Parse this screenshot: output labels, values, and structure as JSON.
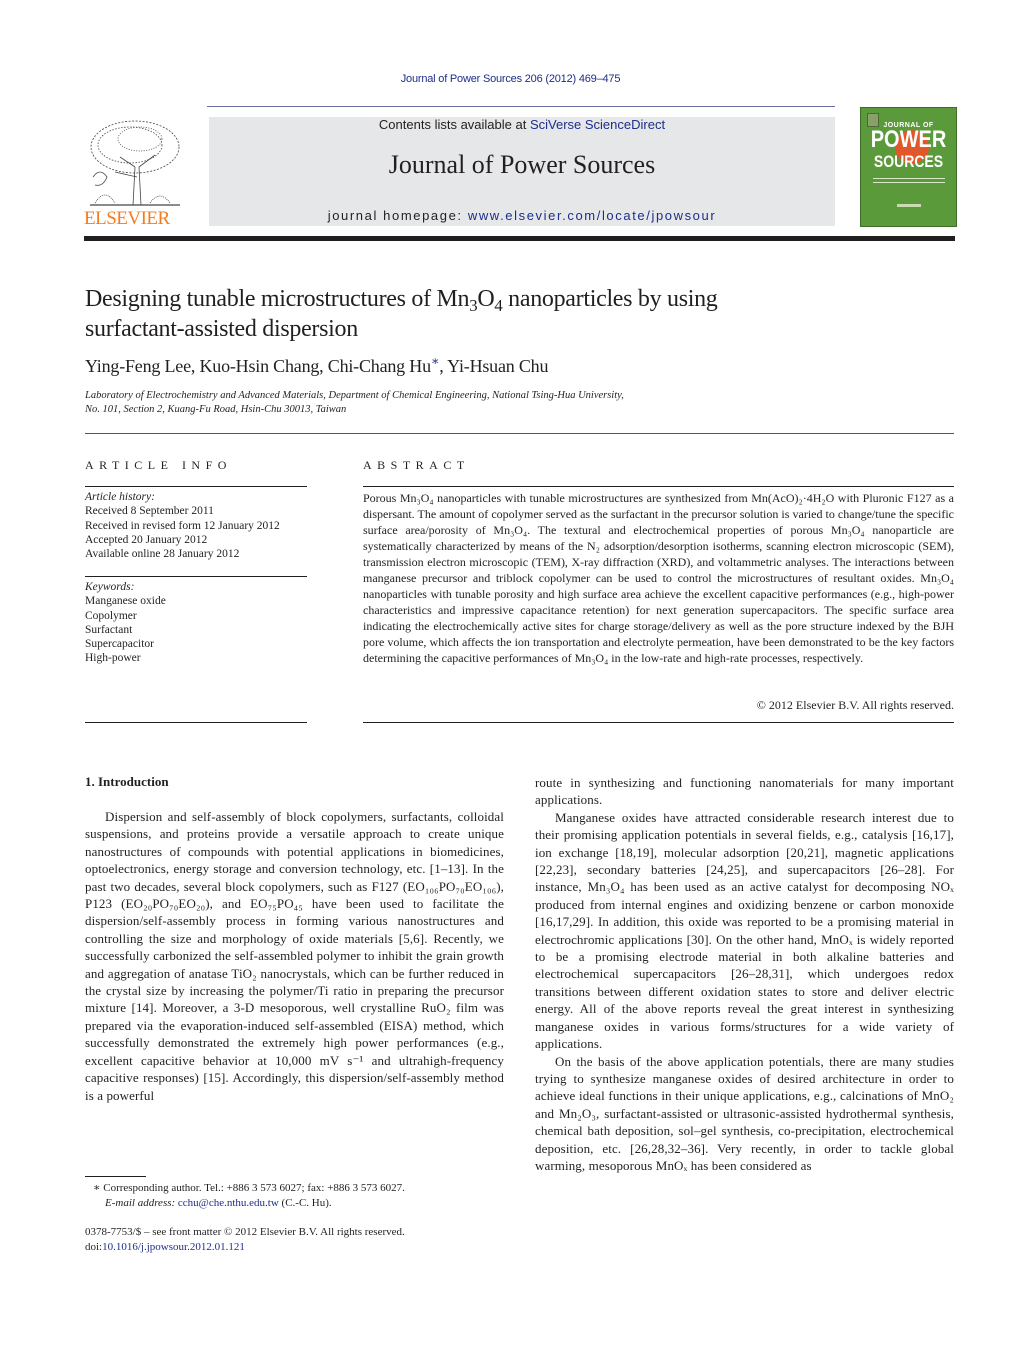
{
  "header": {
    "journal_reference": "Journal of Power Sources 206 (2012) 469–475",
    "contents_prefix": "Contents lists available at ",
    "contents_link": "SciVerse ScienceDirect",
    "journal_title": "Journal of Power Sources",
    "homepage_prefix": "journal homepage: ",
    "homepage_link": "www.elsevier.com/locate/jpowsour",
    "publisher_logo_text": "ELSEVIER",
    "cover": {
      "line1": "JOURNAL OF",
      "line2": "POWER",
      "line3": "SOURCES",
      "bg_color": "#5a9a3a",
      "accent_color": "#e0582a"
    }
  },
  "article": {
    "title_part1": "Designing tunable microstructures of Mn",
    "title_sub1": "3",
    "title_part2": "O",
    "title_sub2": "4",
    "title_part3": " nanoparticles by using",
    "title_line2": "surfactant-assisted dispersion",
    "authors_part1": "Ying-Feng Lee, Kuo-Hsin Chang, Chi-Chang Hu",
    "corresponding_mark": "∗",
    "authors_part2": ", Yi-Hsuan Chu",
    "affiliation_line1": "Laboratory of Electrochemistry and Advanced Materials, Department of Chemical Engineering, National Tsing-Hua University,",
    "affiliation_line2": "No. 101, Section 2, Kuang-Fu Road, Hsin-Chu 30013, Taiwan"
  },
  "article_info": {
    "heading": "ARTICLE INFO",
    "history_label": "Article history:",
    "history": [
      "Received 8 September 2011",
      "Received in revised form 12 January 2012",
      "Accepted 20 January 2012",
      "Available online 28 January 2012"
    ],
    "keywords_label": "Keywords:",
    "keywords": [
      "Manganese oxide",
      "Copolymer",
      "Surfactant",
      "Supercapacitor",
      "High-power"
    ]
  },
  "abstract": {
    "heading": "ABSTRACT",
    "text": "Porous Mn₃O₄ nanoparticles with tunable microstructures are synthesized from Mn(AcO)₂·4H₂O with Pluronic F127 as a dispersant. The amount of copolymer served as the surfactant in the precursor solution is varied to change/tune the specific surface area/porosity of Mn₃O₄. The textural and electrochemical properties of porous Mn₃O₄ nanoparticle are systematically characterized by means of the N₂ adsorption/desorption isotherms, scanning electron microscopic (SEM), transmission electron microscopic (TEM), X-ray diffraction (XRD), and voltammetric analyses. The interactions between manganese precursor and triblock copolymer can be used to control the microstructures of resultant oxides. Mn₃O₄ nanoparticles with tunable porosity and high surface area achieve the excellent capacitive performances (e.g., high-power characteristics and impressive capacitance retention) for next generation supercapacitors. The specific surface area indicating the electrochemically active sites for charge storage/delivery as well as the pore structure indexed by the BJH pore volume, which affects the ion transportation and electrolyte permeation, have been demonstrated to be the key factors determining the capacitive performances of Mn₃O₄ in the low-rate and high-rate processes, respectively.",
    "copyright": "© 2012 Elsevier B.V. All rights reserved."
  },
  "introduction": {
    "heading": "1.  Introduction",
    "col1_para1": "Dispersion and self-assembly of block copolymers, surfactants, colloidal suspensions, and proteins provide a versatile approach to create unique nanostructures of compounds with potential applications in biomedicines, optoelectronics, energy storage and conversion technology, etc. [1–13]. In the past two decades, several block copolymers, such as F127 (EO₁₀₆PO₇₀EO₁₀₆), P123 (EO₂₀PO₇₀EO₂₀), and EO₇₅PO₄₅ have been used to facilitate the dispersion/self-assembly process in forming various nanostructures and controlling the size and morphology of oxide materials [5,6]. Recently, we successfully carbonized the self-assembled polymer to inhibit the grain growth and aggregation of anatase TiO₂ nanocrystals, which can be further reduced in the crystal size by increasing the polymer/Ti ratio in preparing the precursor mixture [14]. Moreover, a 3-D mesoporous, well crystalline RuO₂ film was prepared via the evaporation-induced self-assembled (EISA) method, which successfully demonstrated the extremely high power performances (e.g., excellent capacitive behavior at 10,000 mV s⁻¹ and ultrahigh-frequency capacitive responses) [15]. Accordingly, this dispersion/self-assembly method is a powerful",
    "col2_para0": "route in synthesizing and functioning nanomaterials for many important applications.",
    "col2_para1": "Manganese oxides have attracted considerable research interest due to their promising application potentials in several fields, e.g., catalysis [16,17], ion exchange [18,19], molecular adsorption [20,21], magnetic applications [22,23], secondary batteries [24,25], and supercapacitors [26–28]. For instance, Mn₃O₄ has been used as an active catalyst for decomposing NOₓ produced from internal engines and oxidizing benzene or carbon monoxide [16,17,29]. In addition, this oxide was reported to be a promising material in electrochromic applications [30]. On the other hand, MnOₓ is widely reported to be a promising electrode material in both alkaline batteries and electrochemical supercapacitors [26–28,31], which undergoes redox transitions between different oxidation states to store and deliver electric energy. All of the above reports reveal the great interest in synthesizing manganese oxides in various forms/structures for a wide variety of applications.",
    "col2_para2": "On the basis of the above application potentials, there are many studies trying to synthesize manganese oxides of desired architecture in order to achieve ideal functions in their unique applications, e.g., calcinations of MnO₂ and Mn₂O₃, surfactant-assisted or ultrasonic-assisted hydrothermal synthesis, chemical bath deposition, sol–gel synthesis, co-precipitation, electrochemical deposition, etc. [26,28,32–36]. Very recently, in order to tackle global warming, mesoporous MnOₓ has been considered as"
  },
  "footnotes": {
    "corresponding": "∗ Corresponding author. Tel.: +886 3 573 6027; fax: +886 3 573 6027.",
    "email_label": "E-mail address: ",
    "email": "cchu@che.nthu.edu.tw",
    "email_suffix": " (C.-C. Hu).",
    "issn_line": "0378-7753/$ – see front matter © 2012 Elsevier B.V. All rights reserved.",
    "doi_prefix": "doi:",
    "doi": "10.1016/j.jpowsour.2012.01.121"
  },
  "colors": {
    "link": "#1d2e8a",
    "elsevier_orange": "#f47c20",
    "banner_bg": "#e6e7e8"
  }
}
